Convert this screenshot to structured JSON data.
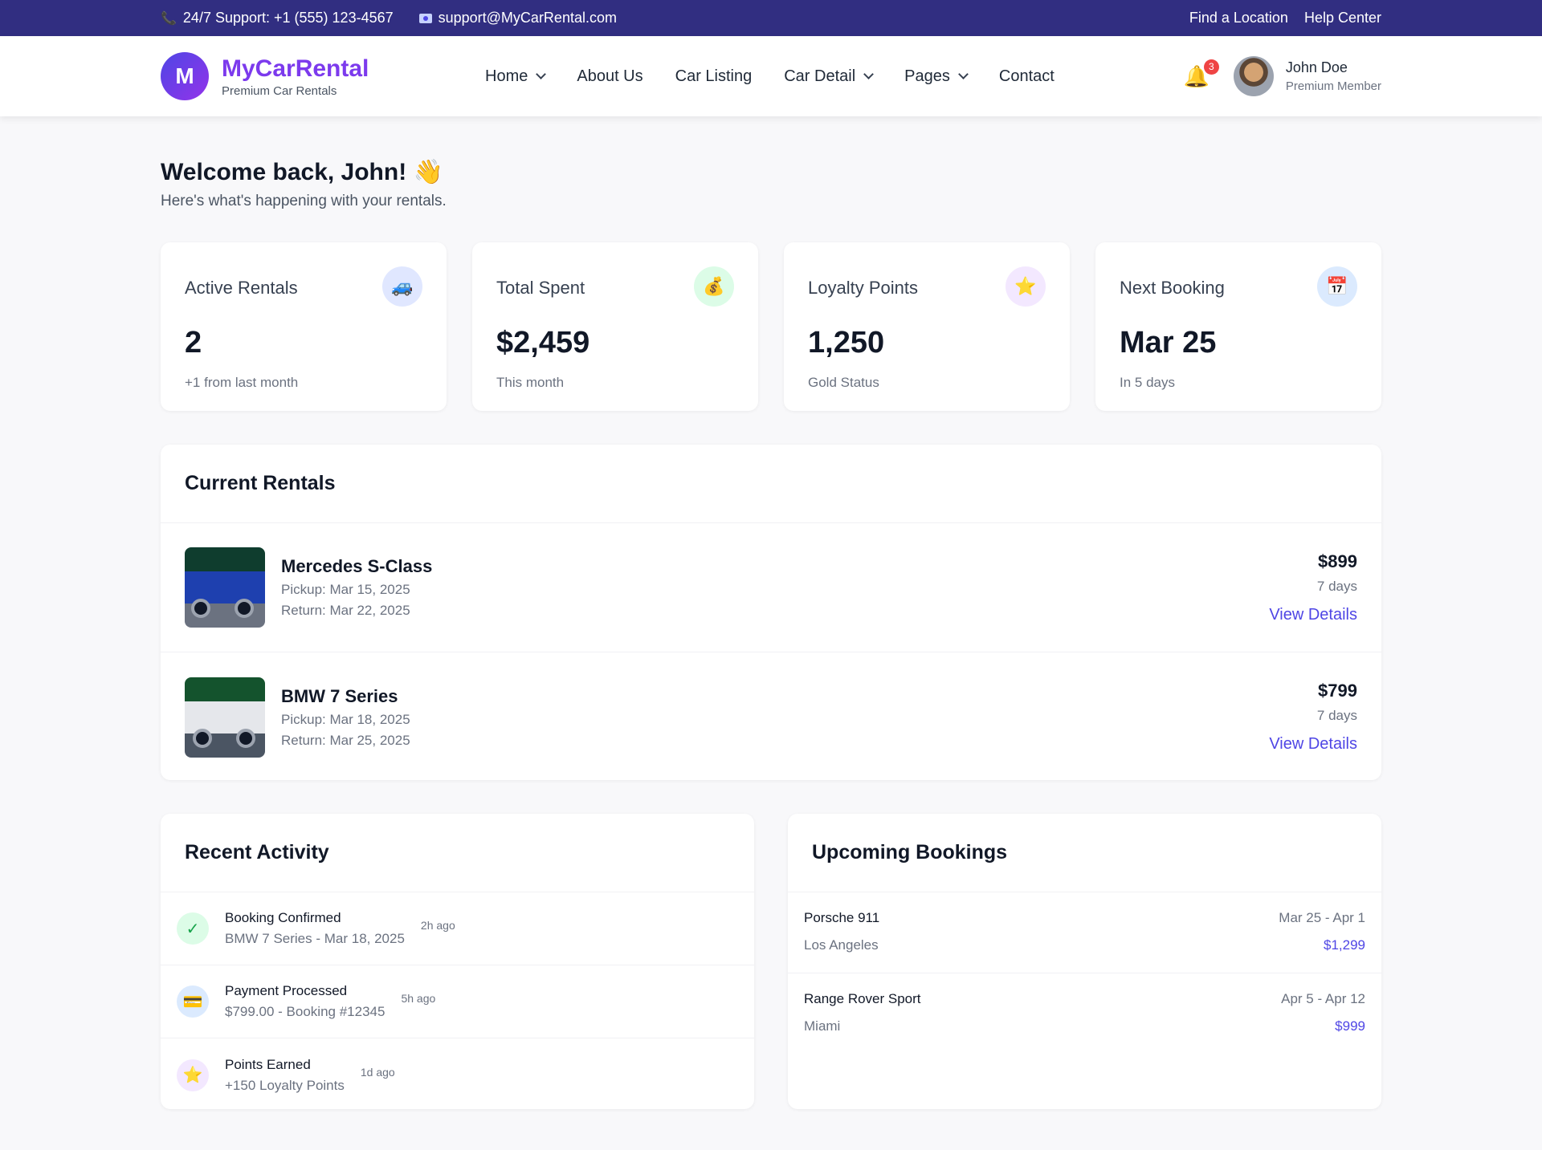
{
  "topbar": {
    "support": "24/7 Support: +1 (555) 123-4567",
    "email": "support@MyCarRental.com",
    "links": [
      "Find a Location",
      "Help Center"
    ]
  },
  "brand": {
    "initial": "M",
    "name": "MyCarRental",
    "tagline": "Premium Car Rentals"
  },
  "nav": [
    "Home",
    "About Us",
    "Car Listing",
    "Car Detail",
    "Pages",
    "Contact"
  ],
  "notifications": {
    "count": "3"
  },
  "user": {
    "name": "John Doe",
    "role": "Premium Member"
  },
  "welcome": {
    "title": "Welcome back, John! 👋",
    "subtitle": "Here's what's happening with your rentals."
  },
  "stats": [
    {
      "label": "Active Rentals",
      "value": "2",
      "sub": "+1 from last month",
      "icon": "car-icon",
      "glyph": "🚙",
      "bg": "#e0e7ff"
    },
    {
      "label": "Total Spent",
      "value": "$2,459",
      "sub": "This month",
      "icon": "money-bag-icon",
      "glyph": "💰",
      "bg": "#dcfce7"
    },
    {
      "label": "Loyalty Points",
      "value": "1,250",
      "sub": "Gold Status",
      "icon": "star-icon",
      "glyph": "⭐",
      "bg": "#f3e8ff"
    },
    {
      "label": "Next Booking",
      "value": "Mar 25",
      "sub": "In 5 days",
      "icon": "calendar-icon",
      "glyph": "📅",
      "bg": "#dbeafe"
    }
  ],
  "current_rentals": {
    "title": "Current Rentals",
    "items": [
      {
        "name": "Mercedes S-Class",
        "pickup": "Pickup: Mar 15, 2025",
        "return": "Return: Mar 22, 2025",
        "price": "$899",
        "days": "7 days",
        "link": "View Details"
      },
      {
        "name": "BMW 7 Series",
        "pickup": "Pickup: Mar 18, 2025",
        "return": "Return: Mar 25, 2025",
        "price": "$799",
        "days": "7 days",
        "link": "View Details"
      }
    ]
  },
  "recent_activity": {
    "title": "Recent Activity",
    "items": [
      {
        "title": "Booking Confirmed",
        "sub": "BMW 7 Series - Mar 18, 2025",
        "time": "2h ago",
        "icon": "check-icon",
        "glyph": "✓",
        "bg": "#dcfce7",
        "color": "#16a34a"
      },
      {
        "title": "Payment Processed",
        "sub": "$799.00 - Booking #12345",
        "time": "5h ago",
        "icon": "credit-card-icon",
        "glyph": "💳",
        "bg": "#dbeafe",
        "color": "#2563eb"
      },
      {
        "title": "Points Earned",
        "sub": "+150 Loyalty Points",
        "time": "1d ago",
        "icon": "star-icon",
        "glyph": "⭐",
        "bg": "#f3e8ff",
        "color": "#eab308"
      }
    ]
  },
  "upcoming_bookings": {
    "title": "Upcoming Bookings",
    "items": [
      {
        "car": "Porsche 911",
        "dates": "Mar 25 - Apr 1",
        "location": "Los Angeles",
        "price": "$1,299"
      },
      {
        "car": "Range Rover Sport",
        "dates": "Apr 5 - Apr 12",
        "location": "Miami",
        "price": "$999"
      }
    ]
  }
}
